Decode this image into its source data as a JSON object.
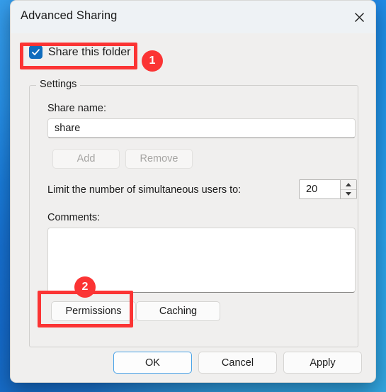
{
  "window": {
    "title": "Advanced Sharing",
    "close_icon": "close-icon"
  },
  "share_checkbox": {
    "label": "Share this folder",
    "checked": true
  },
  "settings_group": {
    "legend": "Settings",
    "share_name_label": "Share name:",
    "share_name_value": "share",
    "add_button": "Add",
    "remove_button": "Remove",
    "limit_label": "Limit the number of simultaneous users to:",
    "limit_value": "20",
    "comments_label": "Comments:",
    "comments_value": "",
    "permissions_button": "Permissions",
    "caching_button": "Caching"
  },
  "footer": {
    "ok_button": "OK",
    "cancel_button": "Cancel",
    "apply_button": "Apply"
  },
  "annotations": {
    "badge_1": "1",
    "badge_2": "2",
    "color": "#fb3434"
  }
}
